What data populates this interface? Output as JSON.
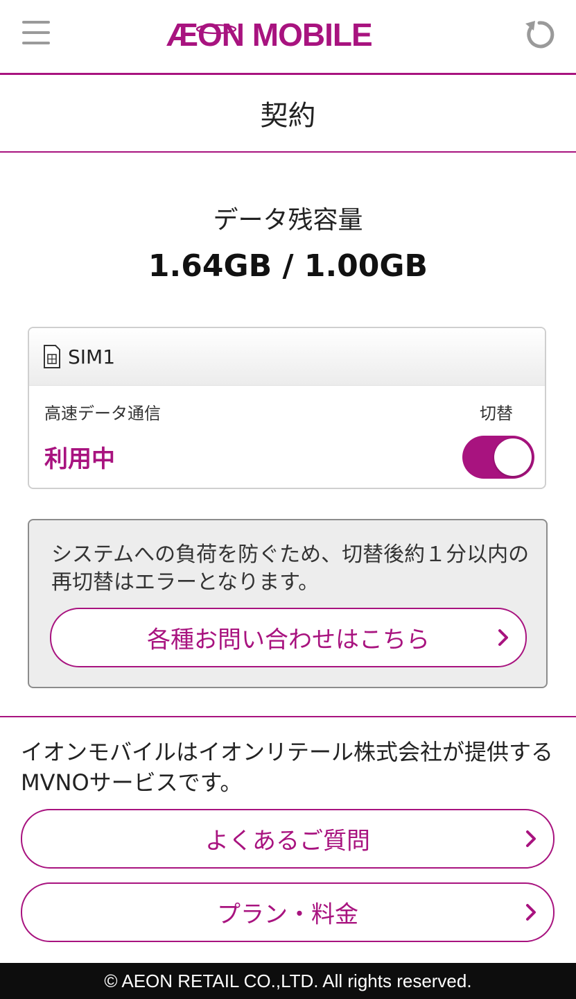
{
  "header": {
    "logo_text": "ÆON MOBILE",
    "menu_icon": "hamburger-menu-icon",
    "reload_icon": "reload-icon"
  },
  "title": "契約",
  "data_remaining": {
    "label": "データ残容量",
    "value": "1.64GB / 1.00GB"
  },
  "sim": {
    "name": "SIM1",
    "high_speed_label": "高速データ通信",
    "switch_label": "切替",
    "status": "利用中",
    "toggle_on": true
  },
  "notice": {
    "text": "システムへの負荷を防ぐため、切替後約１分以内の再切替はエラーとなります。",
    "contact_button": "各種お問い合わせはこちら"
  },
  "about": {
    "text": "イオンモバイルはイオンリテール株式会社が提供するMVNOサービスです。"
  },
  "buttons": {
    "faq": "よくあるご質問",
    "plan": "プラン・料金"
  },
  "footer": {
    "copyright": "© AEON RETAIL CO.,LTD. All rights reserved."
  },
  "colors": {
    "accent": "#a8137f",
    "footer_bg": "#0d0d0d",
    "notice_bg": "#ededed"
  }
}
